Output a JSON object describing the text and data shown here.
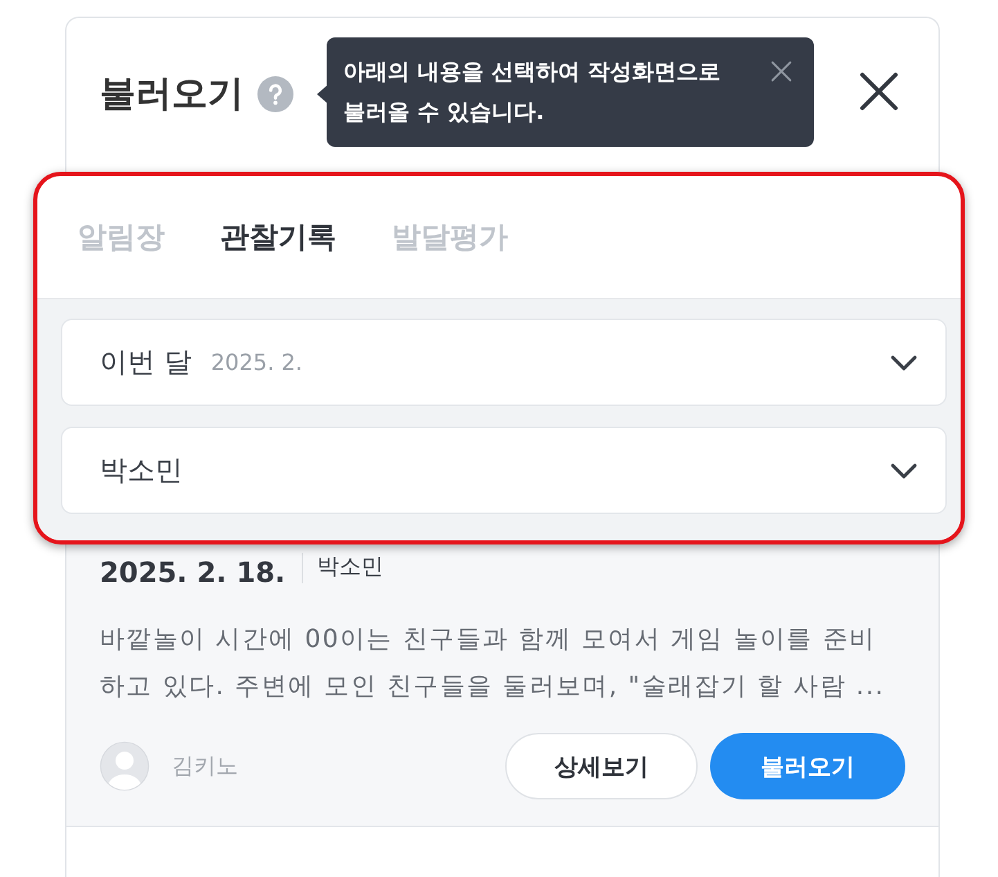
{
  "panel": {
    "title": "불러오기",
    "tooltip": {
      "text": "아래의 내용을 선택하여 작성화면으로 불러올 수 있습니다."
    }
  },
  "tabs": [
    {
      "label": "알림장",
      "selected": false
    },
    {
      "label": "관찰기록",
      "selected": true
    },
    {
      "label": "발달평가",
      "selected": false
    }
  ],
  "filters": [
    {
      "label": "이번 달",
      "value": "2025. 2."
    },
    {
      "label": "박소민"
    }
  ],
  "records": [
    {
      "date": "2025. 2. 18.",
      "child": "박소민",
      "text": "바깥놀이 시간에 00이는 친구들과 함께 모여서 게임 놀이를 준비하고 있다. 주변에 모인 친구들을 둘러보며, \"술래잡기 할 사람 ...",
      "author": "김키노",
      "buttons": [
        {
          "label": "상세보기",
          "kind": "secondary"
        },
        {
          "label": "불러오기",
          "kind": "primary"
        }
      ]
    }
  ]
}
